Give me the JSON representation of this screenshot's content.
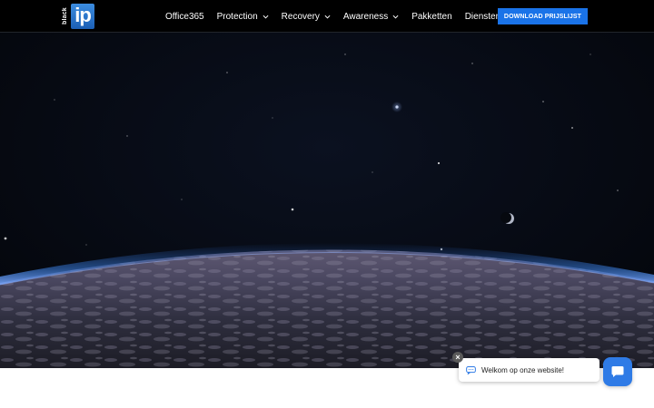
{
  "header": {
    "logo": {
      "side_text": "black",
      "main_text": "ip"
    },
    "nav": [
      {
        "label": "Office365",
        "has_dropdown": false
      },
      {
        "label": "Protection",
        "has_dropdown": true
      },
      {
        "label": "Recovery",
        "has_dropdown": true
      },
      {
        "label": "Awareness",
        "has_dropdown": true
      },
      {
        "label": "Pakketten",
        "has_dropdown": false
      },
      {
        "label": "Diensten",
        "has_dropdown": true
      }
    ],
    "cta_label": "DOWNLOAD PRIJSLIJST"
  },
  "chat": {
    "message": "Welkom op onze website!",
    "close_symbol": "×",
    "launcher_icon": "chat-icon"
  },
  "colors": {
    "header_bg": "#000000",
    "cta_bg": "#1a73e8",
    "chat_launcher": "#2f7be6",
    "logo_blue": "#2b78d0"
  }
}
